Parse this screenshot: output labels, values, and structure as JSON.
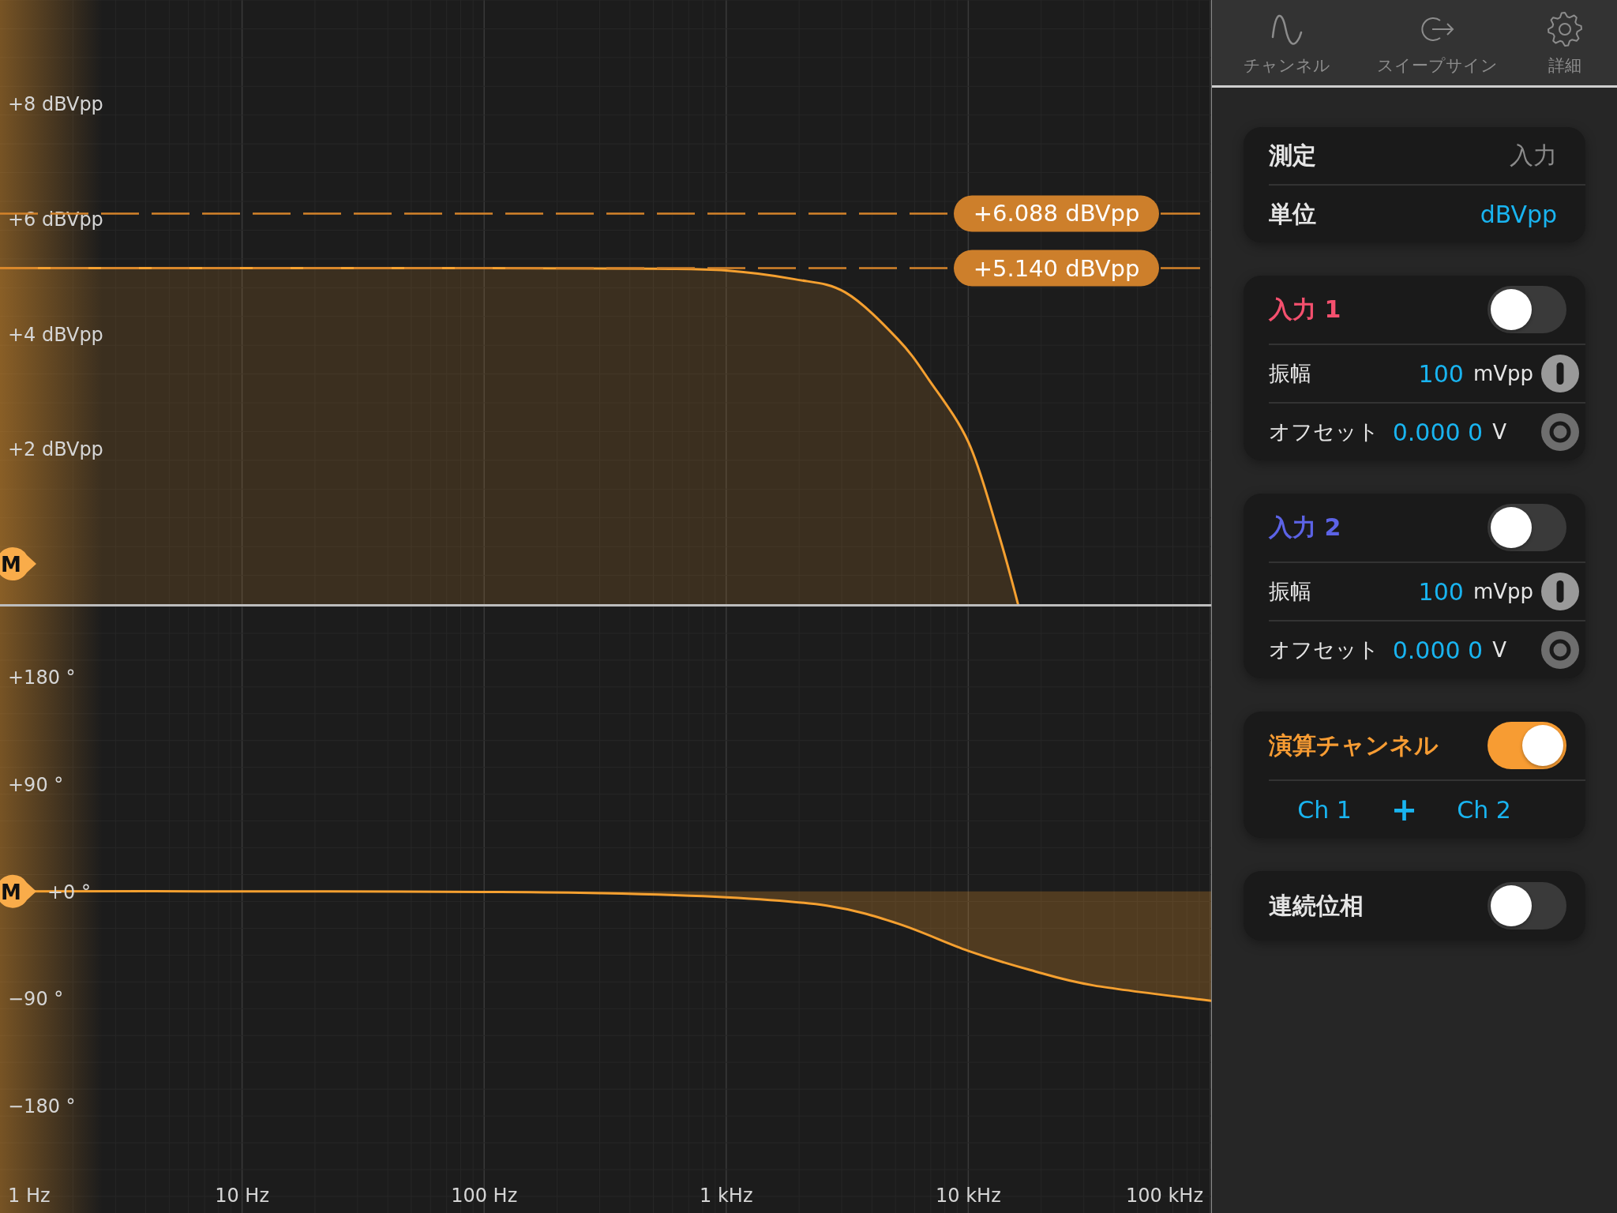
{
  "magnitude_plot": {
    "axis_labels": [
      "+8 dBVpp",
      "+6 dBVpp",
      "+4 dBVpp",
      "+2 dBVpp"
    ],
    "readouts": [
      "+6.088 dBVpp",
      "+5.140 dBVpp"
    ],
    "marker": "M"
  },
  "phase_plot": {
    "axis_labels": [
      "+180 °",
      "+90 °",
      "+0 °",
      "−90 °",
      "−180 °"
    ],
    "frequency_labels": [
      "1 Hz",
      "10 Hz",
      "100 Hz",
      "1 kHz",
      "10 kHz",
      "100 kHz"
    ],
    "marker": "M"
  },
  "tabs": [
    {
      "label": "チャンネル",
      "selected": false
    },
    {
      "label": "スイープサイン",
      "selected": false
    },
    {
      "label": "詳細",
      "selected": false
    }
  ],
  "cards": [
    {
      "rows": [
        {
          "kind": "pair",
          "label": "測定",
          "value": "入力",
          "disabled": true
        },
        {
          "kind": "pair",
          "label": "単位",
          "value": "dBVpp",
          "disabled": false
        }
      ]
    },
    {
      "rows": [
        {
          "kind": "toggle",
          "label": "入力 1",
          "color": "#f4506e",
          "on": false
        },
        {
          "kind": "slider",
          "label": "振幅",
          "value": "100",
          "unit": "mVpp"
        },
        {
          "kind": "dial",
          "label": "オフセット",
          "value": "0.000 0",
          "unit": "V"
        }
      ]
    },
    {
      "rows": [
        {
          "kind": "toggle",
          "label": "入力 2",
          "color": "#5c63e6",
          "on": false
        },
        {
          "kind": "slider",
          "label": "振幅",
          "value": "100",
          "unit": "mVpp"
        },
        {
          "kind": "dial",
          "label": "オフセット",
          "value": "0.000 0",
          "unit": "V"
        }
      ]
    },
    {
      "rows": [
        {
          "kind": "toggle",
          "label": "演算チャンネル",
          "color": "#f79c33",
          "on": true
        },
        {
          "kind": "expression",
          "left": "Ch 1",
          "operator": "+",
          "right": "Ch 2"
        }
      ]
    },
    {
      "rows": [
        {
          "kind": "toggle",
          "label": "連続位相",
          "color": "#e6e6e6",
          "on": false
        }
      ]
    }
  ]
}
